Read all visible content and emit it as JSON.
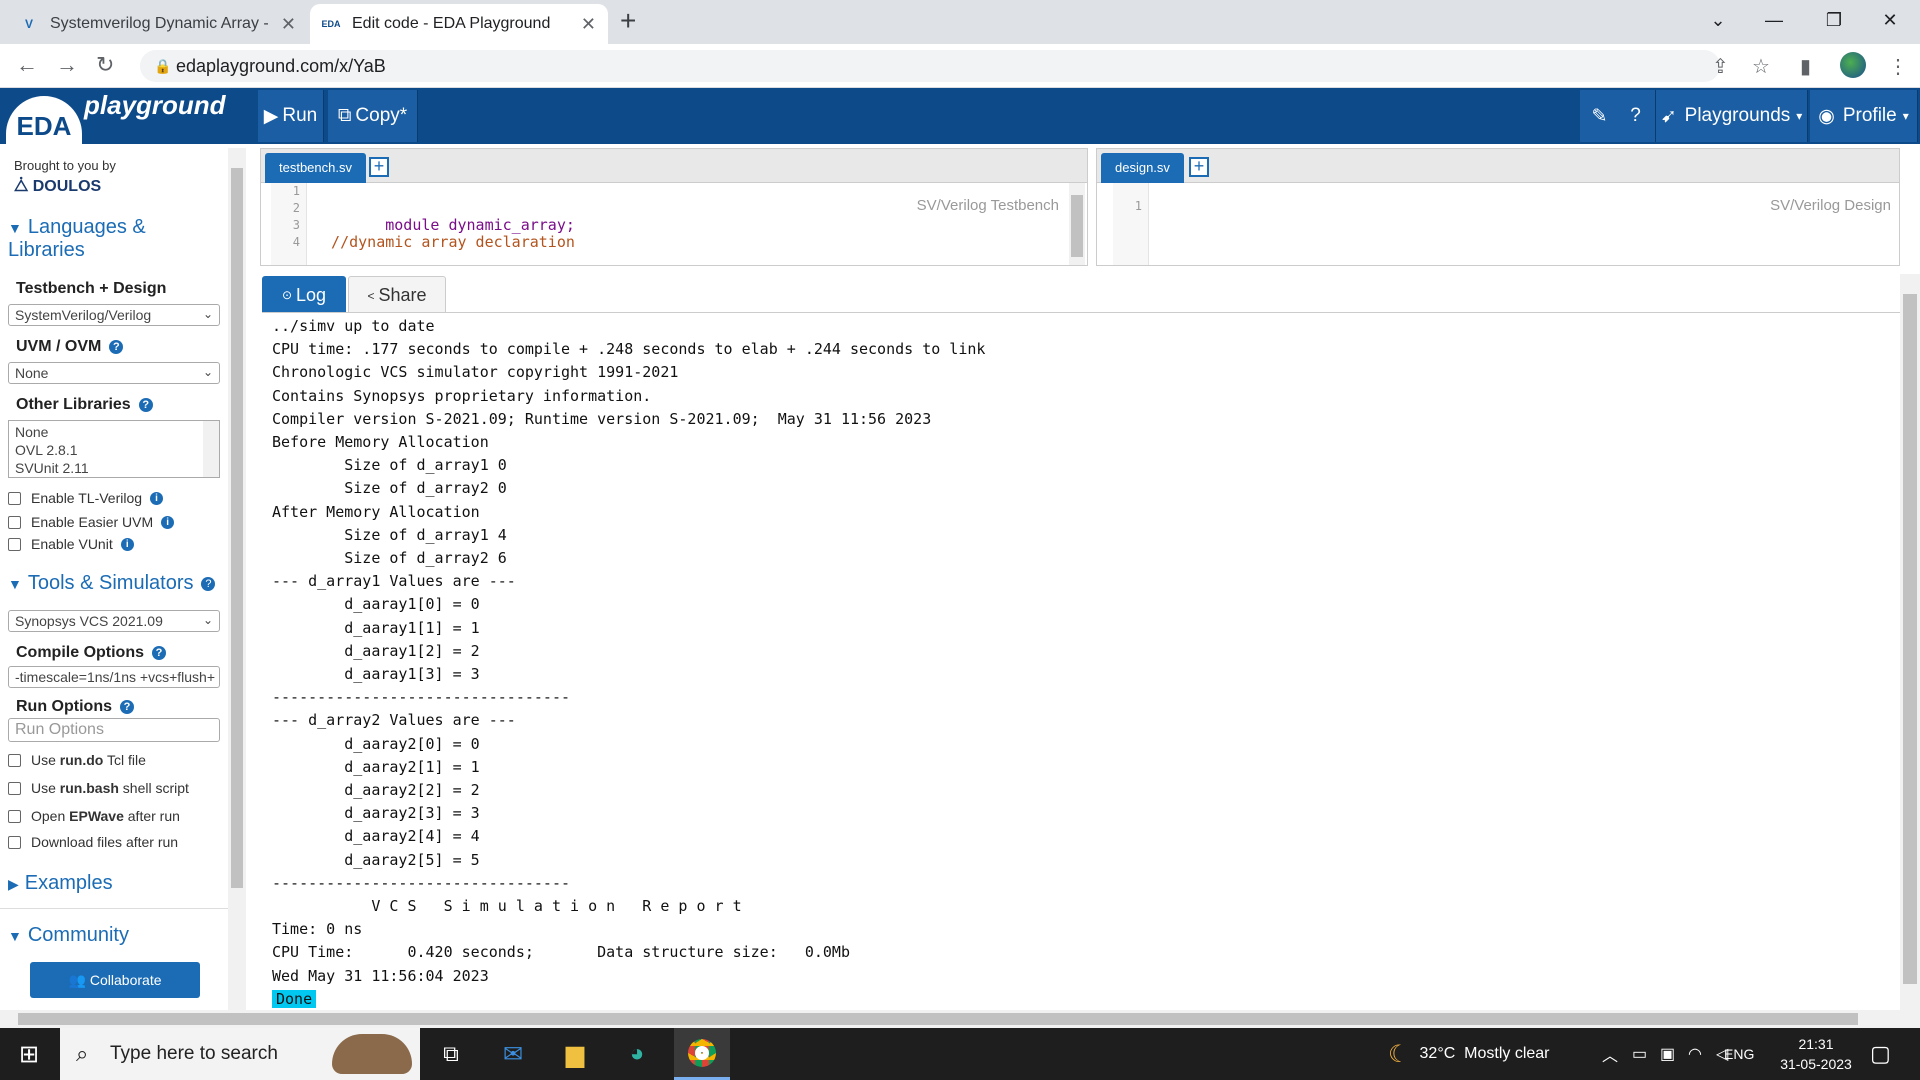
{
  "browser": {
    "tabs": [
      {
        "title": "Systemverilog Dynamic Array - V",
        "favicon": "V"
      },
      {
        "title": "Edit code - EDA Playground",
        "favicon": "EDA"
      }
    ],
    "new_tab": "+",
    "url": "edaplayground.com/x/YaB"
  },
  "header": {
    "logo_eda": "EDA",
    "logo_playground": "playground",
    "run_label": "Run",
    "copy_label": "Copy*",
    "playgrounds_label": "Playgrounds",
    "profile_label": "Profile"
  },
  "sidebar": {
    "brought_by": "Brought to you by",
    "doulos": "DOULOS",
    "languages_heading": "Languages & Libraries",
    "testbench_design_label": "Testbench + Design",
    "testbench_design_value": "SystemVerilog/Verilog",
    "uvm_label": "UVM / OVM",
    "uvm_value": "None",
    "other_libraries_label": "Other Libraries",
    "other_libraries_options": [
      "None",
      "OVL 2.8.1",
      "SVUnit 2.11"
    ],
    "enable_tl": "Enable TL-Verilog",
    "enable_uvm": "Enable Easier UVM",
    "enable_vunit": "Enable VUnit",
    "tools_heading": "Tools & Simulators",
    "simulator_value": "Synopsys VCS 2021.09",
    "compile_label": "Compile Options",
    "compile_value": "-timescale=1ns/1ns +vcs+flush+",
    "run_options_label": "Run Options",
    "run_options_placeholder": "Run Options",
    "use_rundo_pre": "Use ",
    "use_rundo_bold": "run.do",
    "use_rundo_post": " Tcl file",
    "use_runbash_pre": "Use ",
    "use_runbash_bold": "run.bash",
    "use_runbash_post": " shell script",
    "open_epwave_pre": "Open ",
    "open_epwave_bold": "EPWave",
    "open_epwave_post": " after run",
    "download_files": "Download files after run",
    "examples_heading": "Examples",
    "community_heading": "Community",
    "collaborate": "Collaborate"
  },
  "editor_left": {
    "tab": "testbench.sv",
    "mode": "SV/Verilog Testbench",
    "lines": [
      "1",
      "2",
      "3",
      "4"
    ],
    "code": [
      "",
      "module dynamic_array;",
      "",
      "  //dynamic array declaration"
    ]
  },
  "editor_right": {
    "tab": "design.sv",
    "mode": "SV/Verilog Design",
    "lines": [
      "1"
    ]
  },
  "log": {
    "log_tab": "Log",
    "share_tab": "Share",
    "lines": [
      "../simv up to date",
      "CPU time: .177 seconds to compile + .248 seconds to elab + .244 seconds to link",
      "Chronologic VCS simulator copyright 1991-2021",
      "Contains Synopsys proprietary information.",
      "Compiler version S-2021.09; Runtime version S-2021.09;  May 31 11:56 2023",
      "Before Memory Allocation",
      "        Size of d_array1 0",
      "        Size of d_array2 0",
      "After Memory Allocation",
      "        Size of d_array1 4",
      "        Size of d_array2 6",
      "--- d_array1 Values are ---",
      "        d_aaray1[0] = 0",
      "        d_aaray1[1] = 1",
      "        d_aaray1[2] = 2",
      "        d_aaray1[3] = 3",
      "---------------------------------",
      "--- d_array2 Values are ---",
      "        d_aaray2[0] = 0",
      "        d_aaray2[1] = 1",
      "        d_aaray2[2] = 2",
      "        d_aaray2[3] = 3",
      "        d_aaray2[4] = 4",
      "        d_aaray2[5] = 5",
      "---------------------------------",
      "           V C S   S i m u l a t i o n   R e p o r t",
      "Time: 0 ns",
      "CPU Time:      0.420 seconds;       Data structure size:   0.0Mb",
      "Wed May 31 11:56:04 2023"
    ],
    "done": "Done"
  },
  "taskbar": {
    "search_placeholder": "Type here to search",
    "weather": "32°C  Mostly clear",
    "lang": "ENG",
    "time": "21:31",
    "date": "31-05-2023"
  }
}
